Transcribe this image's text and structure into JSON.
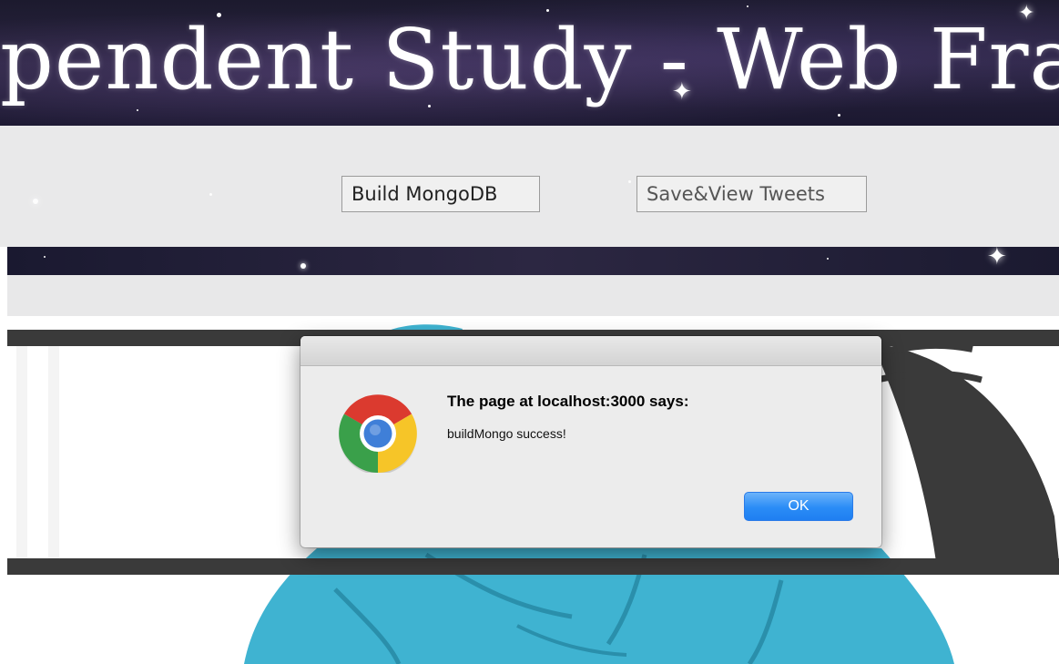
{
  "banner": {
    "title": "pendent Study - Web Fra"
  },
  "nav": {
    "build_label": "Build MongoDB",
    "tweets_label": "Save&View Tweets"
  },
  "dialog": {
    "heading": "The page at localhost:3000 says:",
    "message": "buildMongo success!",
    "ok_label": "OK",
    "icon": "chrome-icon"
  },
  "colors": {
    "ok_button": "#2a8cf6",
    "avatar_hair": "#3fb3d1",
    "avatar_dark": "#3a3a3a"
  }
}
